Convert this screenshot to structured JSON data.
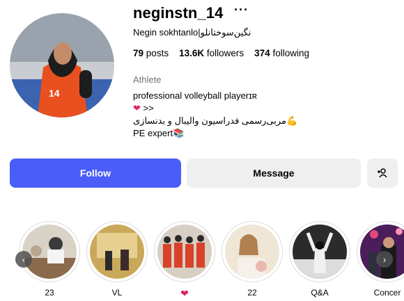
{
  "profile": {
    "username": "neginstn_14",
    "more_label": "···",
    "full_name": "Negin sokhtanlo|نگین‌سوختانلو",
    "stats": {
      "posts_count": "79",
      "posts_label": "posts",
      "followers_count": "13.6K",
      "followers_label": "followers",
      "following_count": "374",
      "following_label": "following"
    },
    "category": "Athlete",
    "bio": {
      "line1": "professional volleyball playerɪʀ",
      "line2_suffix": ">>",
      "line3": "مربی‌رسمی فدراسیون والیبال و بدنسازی",
      "line4": "PE expert"
    }
  },
  "actions": {
    "follow_label": "Follow",
    "message_label": "Message"
  },
  "highlights": [
    {
      "label": "23",
      "icon": "photo"
    },
    {
      "label": "VL",
      "icon": "photo"
    },
    {
      "label": "",
      "icon": "heart-icon",
      "color": "#e0245e"
    },
    {
      "label": "22",
      "icon": "photo"
    },
    {
      "label": "Q&A",
      "icon": "photo"
    },
    {
      "label": "Concer",
      "icon": "photo"
    }
  ],
  "colors": {
    "follow_button": "#4a5df9",
    "secondary_button": "#efefef",
    "jersey": "#e8501f"
  }
}
